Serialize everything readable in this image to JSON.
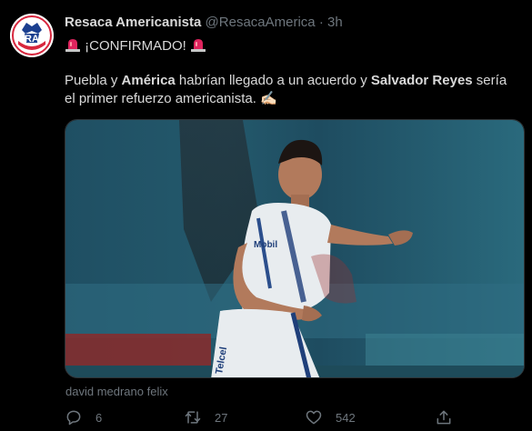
{
  "tweet": {
    "display_name": "Resaca Americanista",
    "handle": "@ResacaAmerica",
    "separator": "·",
    "time": "3h",
    "avatar_letters": "RA",
    "line1": "¡CONFIRMADO!",
    "body": {
      "t1": "Puebla y ",
      "b1": "América",
      "t2": " habrían llegado a un acuerdo y ",
      "b2": "Salvador Reyes",
      "t3": " sería el primer refuerzo americanista. ",
      "emoji": "✍🏻"
    },
    "media_credit": "david medrano felix",
    "jersey": {
      "brand": "Mobil",
      "sponsor": "Telcel"
    }
  },
  "actions": {
    "reply_count": "6",
    "retweet_count": "27",
    "like_count": "542"
  },
  "icons": {
    "reply": "reply-icon",
    "retweet": "retweet-icon",
    "like": "heart-icon",
    "share": "share-icon",
    "siren": "siren-icon"
  },
  "colors": {
    "background": "#000000",
    "text": "#d9d9d9",
    "muted": "#6e767d",
    "siren_red": "#e0245e"
  }
}
